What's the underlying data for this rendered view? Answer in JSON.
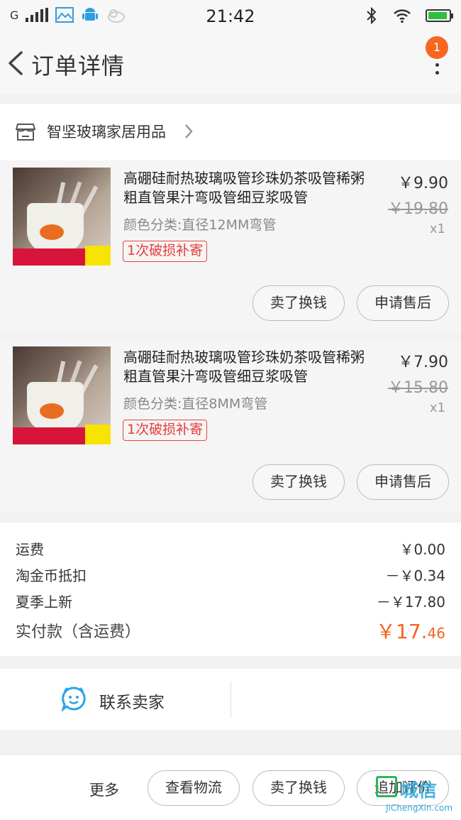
{
  "status_bar": {
    "carrier": "G",
    "time": "21:42",
    "icons": [
      "signal-icon",
      "image-icon",
      "android-icon",
      "weather-icon",
      "bluetooth-icon",
      "wifi-icon",
      "battery-icon"
    ]
  },
  "header": {
    "title": "订单详情",
    "badge_count": "1"
  },
  "shop": {
    "name": "智坚玻璃家居用品"
  },
  "items": [
    {
      "title": "高硼硅耐热玻璃吸管珍珠奶茶吸管稀粥粗直管果汁弯吸管细豆浆吸管",
      "spec": "颜色分类:直径12MM弯管",
      "tag": "1次破损补寄",
      "price": "￥9.90",
      "original_price": "￥19.80",
      "quantity": "x1",
      "btn_sell": "卖了换钱",
      "btn_aftersale": "申请售后"
    },
    {
      "title": "高硼硅耐热玻璃吸管珍珠奶茶吸管稀粥粗直管果汁弯吸管细豆浆吸管",
      "spec": "颜色分类:直径8MM弯管",
      "tag": "1次破损补寄",
      "price": "￥7.90",
      "original_price": "￥15.80",
      "quantity": "x1",
      "btn_sell": "卖了换钱",
      "btn_aftersale": "申请售后"
    }
  ],
  "fees": {
    "shipping_label": "运费",
    "shipping_value": "￥0.00",
    "coin_label": "淘金币抵扣",
    "coin_value": "－￥0.34",
    "promo_label": "夏季上新",
    "promo_value": "－￥17.80",
    "paid_label": "实付款（含运费）",
    "paid_int": "￥17.",
    "paid_dec": "46"
  },
  "contact": {
    "label": "联系卖家"
  },
  "bottom_bar": {
    "more": "更多",
    "logistics": "查看物流",
    "sell": "卖了换钱",
    "review": "追加评价"
  },
  "watermark": {
    "text": "城信",
    "sub": "JiChengXin.com"
  },
  "colors": {
    "accent": "#f5621f",
    "badge": "#f8661f",
    "tag_red": "#e83a3a",
    "contact_blue": "#29a3e8"
  }
}
